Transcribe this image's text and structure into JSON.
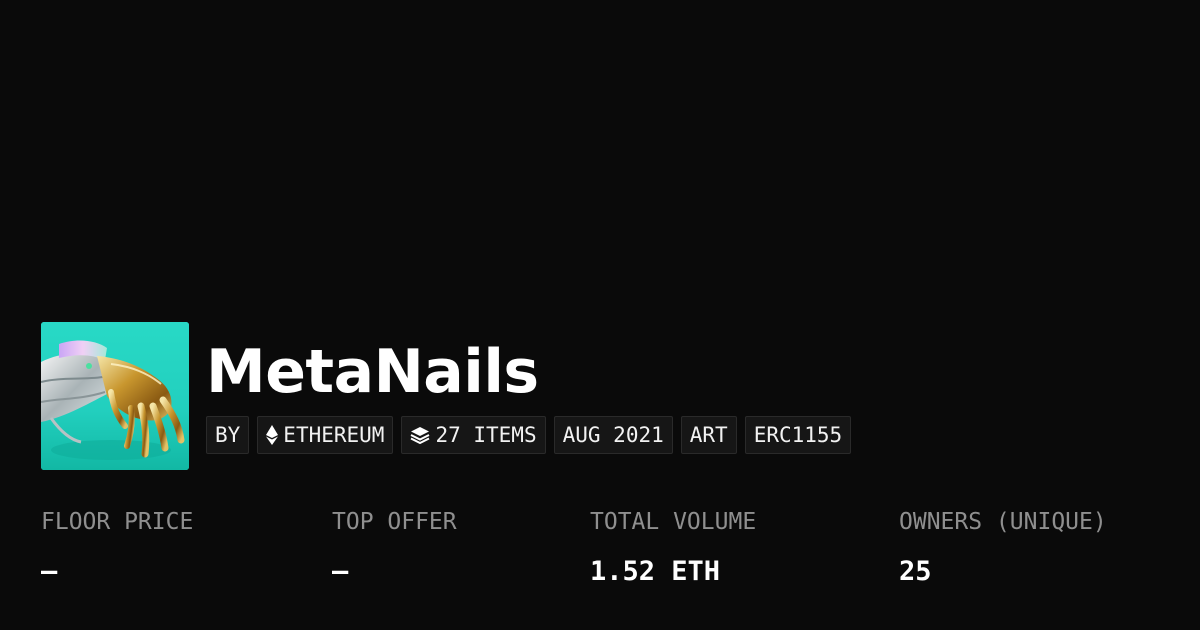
{
  "collection": {
    "name": "MetaNails",
    "avatar_icon": "metallic-hand-artwork"
  },
  "tags": [
    {
      "label": "BY",
      "icon": null
    },
    {
      "label": "ETHEREUM",
      "icon": "ethereum-icon"
    },
    {
      "label": "27 ITEMS",
      "icon": "layers-icon"
    },
    {
      "label": "AUG 2021",
      "icon": null
    },
    {
      "label": "ART",
      "icon": null
    },
    {
      "label": "ERC1155",
      "icon": null
    }
  ],
  "stats": [
    {
      "label": "FLOOR PRICE",
      "value": "–"
    },
    {
      "label": "TOP OFFER",
      "value": "–"
    },
    {
      "label": "TOTAL VOLUME",
      "value": "1.52 ETH"
    },
    {
      "label": "OWNERS (UNIQUE)",
      "value": "25"
    }
  ],
  "colors": {
    "background": "#0a0a0a",
    "tag_background": "#161616",
    "label_gray": "#8f8f8f",
    "avatar_teal": "#1fd6c3"
  }
}
